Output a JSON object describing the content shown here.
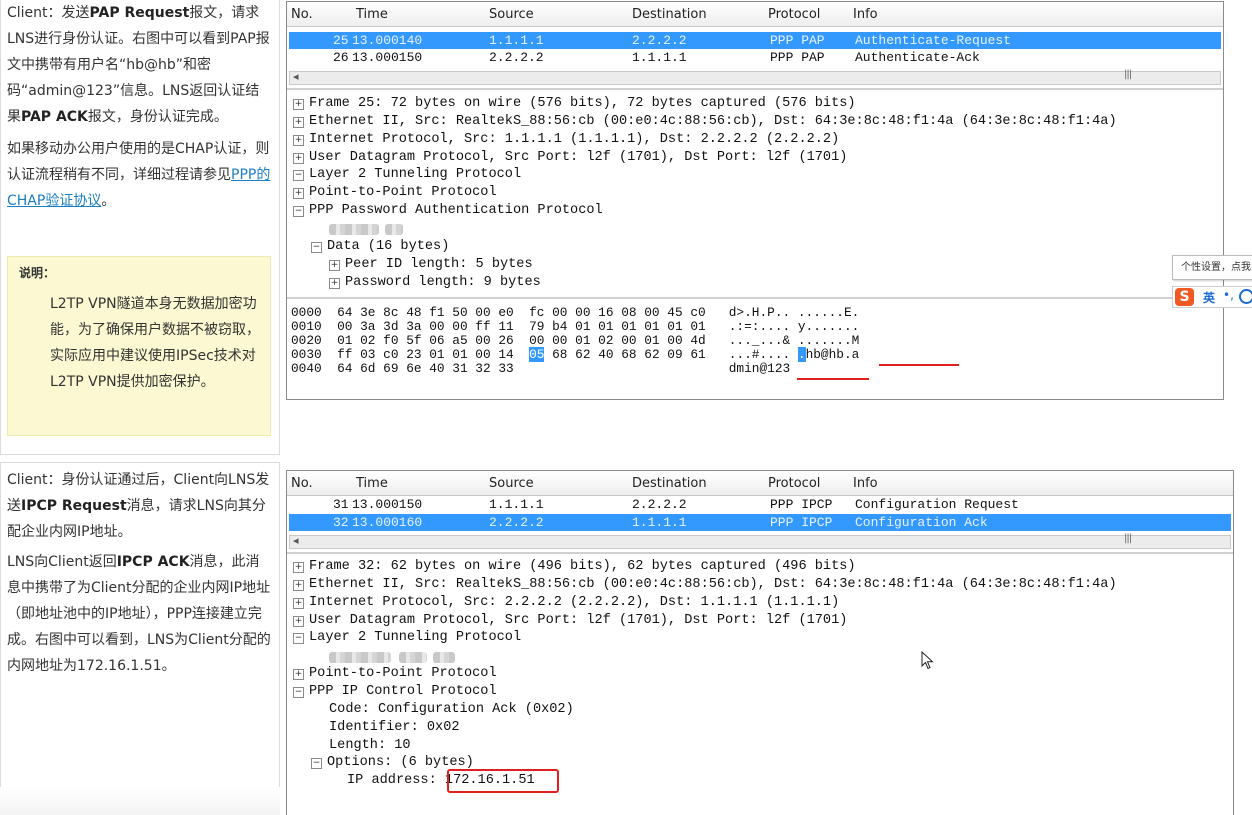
{
  "left_top": {
    "para1_a": "Client：发送",
    "para1_b": "PAP Request",
    "para1_c": "报文，请求LNS进行身份认证。右图中可以看到PAP报文中携带有用户名“hb@hb”和密码“admin@123”信息。LNS返回认证结果",
    "para1_d": "PAP ACK",
    "para1_e": "报文，身份认证完成。",
    "para2_a": "如果移动办公用户使用的是CHAP认证，则认证流程稍有不同，详细过程请参见",
    "para2_link": "PPP的CHAP验证协议",
    "para2_b": "。",
    "note_title": "说明：",
    "note_body": "L2TP VPN隧道本身无数据加密功能，为了确保用户数据不被窃取，实际应用中建议使用IPSec技术对L2TP VPN提供加密保护。"
  },
  "left_bottom": {
    "para1_a": "Client：身份认证通过后，Client向LNS发送",
    "para1_b": "IPCP Request",
    "para1_c": "消息，请求LNS向其分配企业内网IP地址。",
    "para2_a": "LNS向Client返回",
    "para2_b": "IPCP ACK",
    "para2_c": "消息，此消息中携带了为Client分配的企业内网IP地址（即地址池中的IP地址），PPP连接建立完成。右图中可以看到，LNS为Client分配的内网地址为172.16.1.51。"
  },
  "columns": {
    "no": "No.",
    "time": "Time",
    "source": "Source",
    "destination": "Destination",
    "protocol": "Protocol",
    "info": "Info"
  },
  "capture1": {
    "packets": [
      {
        "no": "25",
        "time": "13.000140",
        "src": "1.1.1.1",
        "dst": "2.2.2.2",
        "proto": "PPP PAP",
        "info": "Authenticate-Request"
      },
      {
        "no": "26",
        "time": "13.000150",
        "src": "2.2.2.2",
        "dst": "1.1.1.1",
        "proto": "PPP PAP",
        "info": "Authenticate-Ack"
      }
    ],
    "tree": {
      "frame": "Frame 25: 72 bytes on wire (576 bits), 72 bytes captured (576 bits)",
      "eth": "Ethernet II, Src: RealtekS_88:56:cb (00:e0:4c:88:56:cb), Dst: 64:3e:8c:48:f1:4a (64:3e:8c:48:f1:4a)",
      "ip": "Internet Protocol, Src: 1.1.1.1 (1.1.1.1), Dst: 2.2.2.2 (2.2.2.2)",
      "udp": "User Datagram Protocol, Src Port: l2f (1701), Dst Port: l2f (1701)",
      "l2tp": "Layer 2 Tunneling Protocol",
      "ppp": "Point-to-Point Protocol",
      "pap": "PPP Password Authentication Protocol",
      "data": "Data (16 bytes)",
      "peer": "Peer ID length: 5 bytes",
      "pwd": "Password length: 9 bytes"
    },
    "hex": [
      {
        "off": "0000",
        "bytes": "64 3e 8c 48 f1 50 00 e0  fc 00 00 16 08 00 45 c0",
        "ascii": "d>.H.P.. ......E."
      },
      {
        "off": "0010",
        "bytes": "00 3a 3d 3a 00 00 ff 11  79 b4 01 01 01 01 01 01",
        "ascii": ".:=:.... y......."
      },
      {
        "off": "0020",
        "bytes": "01 02 f0 5f 06 a5 00 26  00 00 01 02 00 01 00 4d",
        "ascii": "..._...& .......M"
      },
      {
        "off": "0030",
        "bytes_a": "ff 03 c0 23 01 01 00 14  ",
        "bytes_hl": "05",
        "bytes_b": " 68 62 40 68 62 09 61",
        "ascii_a": "...#.... ",
        "ascii_hl": ".",
        "ascii_b": "hb@hb.a"
      },
      {
        "off": "0040",
        "bytes": "64 6d 69 6e 40 31 32 33",
        "ascii": "dmin@123"
      }
    ]
  },
  "capture2": {
    "packets": [
      {
        "no": "31",
        "time": "13.000150",
        "src": "1.1.1.1",
        "dst": "2.2.2.2",
        "proto": "PPP IPCP",
        "info": "Configuration Request"
      },
      {
        "no": "32",
        "time": "13.000160",
        "src": "2.2.2.2",
        "dst": "1.1.1.1",
        "proto": "PPP IPCP",
        "info": "Configuration Ack"
      }
    ],
    "tree": {
      "frame": "Frame 32: 62 bytes on wire (496 bits), 62 bytes captured (496 bits)",
      "eth": "Ethernet II, Src: RealtekS_88:56:cb (00:e0:4c:88:56:cb), Dst: 64:3e:8c:48:f1:4a (64:3e:8c:48:f1:4a)",
      "ip": "Internet Protocol, Src: 2.2.2.2 (2.2.2.2), Dst: 1.1.1.1 (1.1.1.1)",
      "udp": "User Datagram Protocol, Src Port: l2f (1701), Dst Port: l2f (1701)",
      "l2tp": "Layer 2 Tunneling Protocol",
      "ppp": "Point-to-Point Protocol",
      "ipcp": "PPP IP Control Protocol",
      "code": "Code: Configuration Ack (0x02)",
      "ident": "Identifier: 0x02",
      "length": "Length: 10",
      "options": "Options: (6 bytes)",
      "ipaddr_label": "IP address: ",
      "ipaddr_value": "172.16.1.51"
    }
  },
  "overlay": {
    "tooltip": "个性设置，点我",
    "ime_logo": "S",
    "ime_lang": "英",
    "ime_punct": "•,"
  },
  "colors": {
    "selection": "#3399ff",
    "annotation": "#e0201f",
    "note_bg": "#fcf8d2",
    "link": "#1a7ec3"
  },
  "icons": [
    "expand-plus-icon",
    "collapse-minus-icon",
    "scroll-left-arrow-icon",
    "mouse-pointer-icon",
    "sogou-ime-icon"
  ]
}
